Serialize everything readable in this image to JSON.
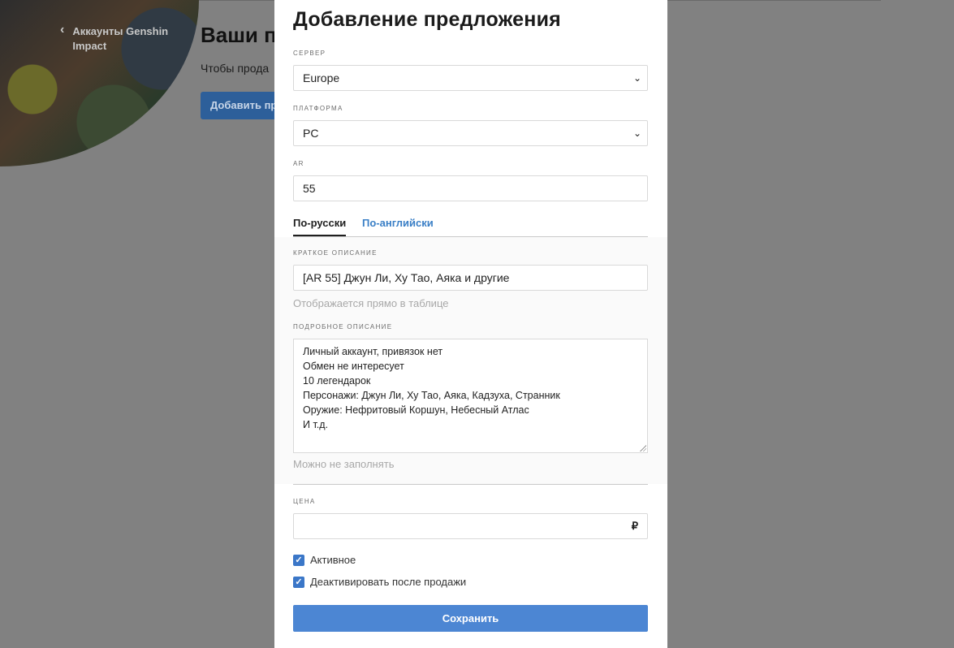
{
  "background": {
    "back_link": "Аккаунты Genshin Impact",
    "page_title": "Ваши п",
    "page_text": "Чтобы прода",
    "add_button": "Добавить пр"
  },
  "modal": {
    "title": "Добавление предложения",
    "server": {
      "label": "СЕРВЕР",
      "value": "Europe"
    },
    "platform": {
      "label": "ПЛАТФОРМА",
      "value": "PC"
    },
    "ar": {
      "label": "AR",
      "value": "55"
    },
    "tabs": [
      {
        "label": "По-русски",
        "active": true
      },
      {
        "label": "По-английски",
        "active": false
      }
    ],
    "short_desc": {
      "label": "КРАТКОЕ ОПИСАНИЕ",
      "value": "[AR 55] Джун Ли,  Ху Тао, Аяка и другие",
      "hint": "Отображается прямо в таблице"
    },
    "long_desc": {
      "label": "ПОДРОБНОЕ ОПИСАНИЕ",
      "lines": [
        "Личный аккаунт, привязок нет",
        "Обмен не интересует",
        "10 легендарок",
        "Персонажи: Джун Ли, Ху Тао, Аяка, Кадзуха, Странник",
        "Оружие: Нефритовый Коршун, Небесный Атлас",
        "И т.д."
      ],
      "hint": "Можно не заполнять"
    },
    "price": {
      "label": "ЦЕНА",
      "value": "",
      "currency": "₽"
    },
    "active_checkbox": {
      "label": "Активное",
      "checked": true
    },
    "deactivate_checkbox": {
      "label": "Деактивировать после продажи",
      "checked": true
    },
    "save_button": "Сохранить"
  },
  "colors": {
    "accent": "#4c86d3",
    "tab_link": "#3a7fc6",
    "overlay": "#808080"
  }
}
